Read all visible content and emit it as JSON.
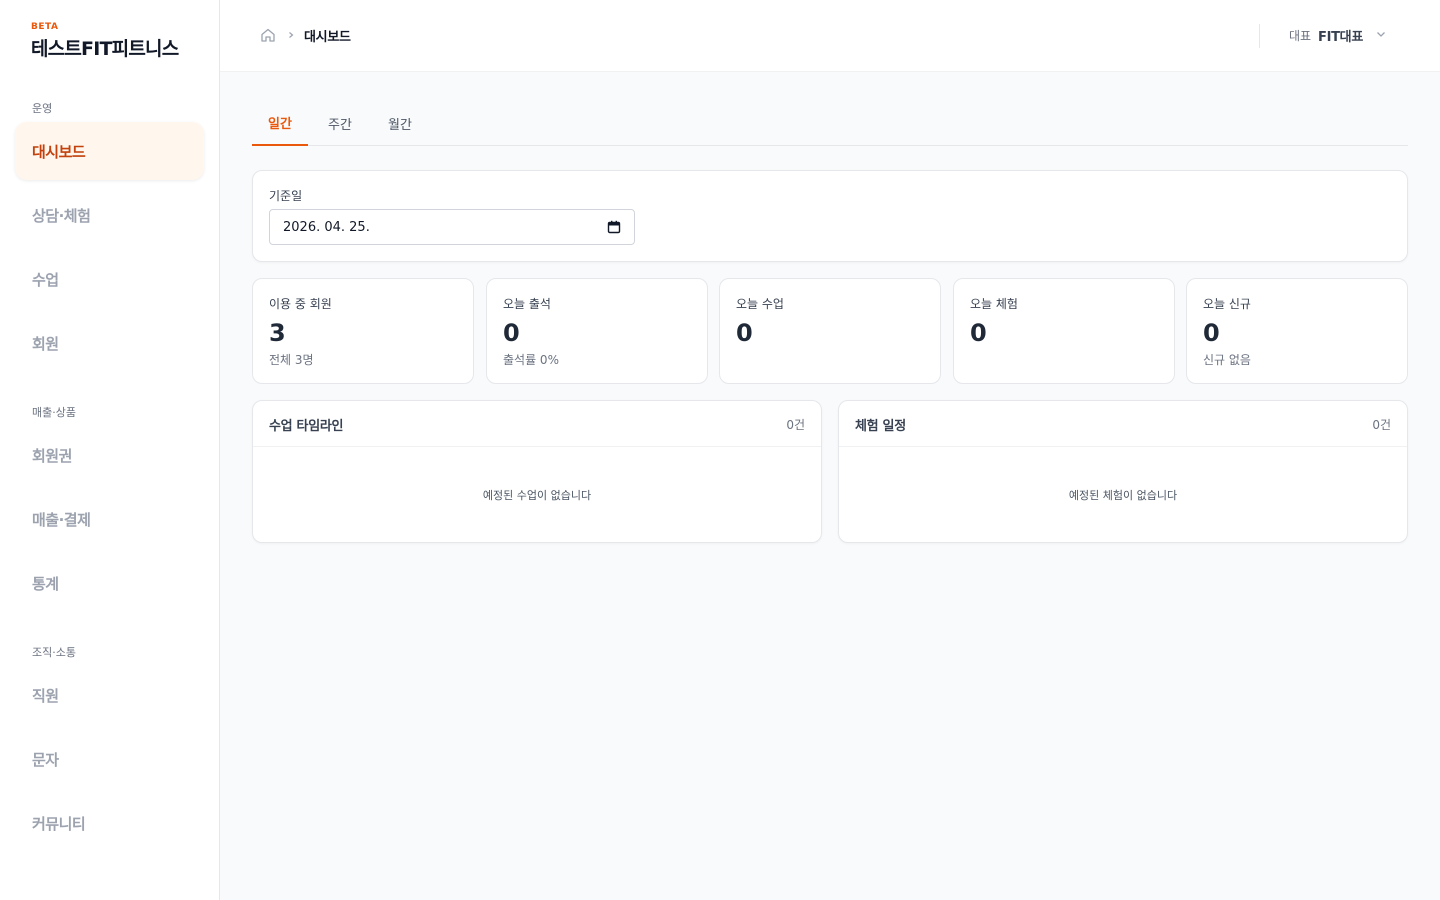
{
  "brand": {
    "badge": "BETA",
    "name": "테스트FIT피트니스"
  },
  "sidebar": {
    "sections": [
      {
        "label": "운영"
      },
      {
        "label": "매출·상품"
      },
      {
        "label": "조직·소통"
      }
    ],
    "items": [
      {
        "label": "대시보드",
        "active": true
      },
      {
        "label": "상담·체험"
      },
      {
        "label": "수업"
      },
      {
        "label": "회원"
      },
      {
        "label": "회원권"
      },
      {
        "label": "매출·결제"
      },
      {
        "label": "통계"
      },
      {
        "label": "직원"
      },
      {
        "label": "문자"
      },
      {
        "label": "커뮤니티"
      }
    ]
  },
  "header": {
    "breadcrumb_current": "대시보드",
    "user_role": "대표",
    "user_name": "FIT대표",
    "icons": [
      "home-icon",
      "chevron-right-icon",
      "chevron-down-icon"
    ]
  },
  "tabs": [
    {
      "label": "일간",
      "active": true
    },
    {
      "label": "주간"
    },
    {
      "label": "월간"
    }
  ],
  "date_filter": {
    "label": "기준일",
    "value": "2026. 04. 25."
  },
  "stats": [
    {
      "label": "이용 중 회원",
      "value": "3",
      "sub": "전체 3명"
    },
    {
      "label": "오늘 출석",
      "value": "0",
      "sub": "출석률 0%"
    },
    {
      "label": "오늘 수업",
      "value": "0",
      "sub": ""
    },
    {
      "label": "오늘 체험",
      "value": "0",
      "sub": ""
    },
    {
      "label": "오늘 신규",
      "value": "0",
      "sub": "신규 없음"
    }
  ],
  "panels": [
    {
      "title": "수업 타임라인",
      "count": "0건",
      "empty": "예정된 수업이 없습니다"
    },
    {
      "title": "체험 일정",
      "count": "0건",
      "empty": "예정된 체험이 없습니다"
    }
  ],
  "colors": {
    "accent": "#ea580c",
    "accent_bg": "#fff7ed",
    "active_text": "#c2410c"
  }
}
